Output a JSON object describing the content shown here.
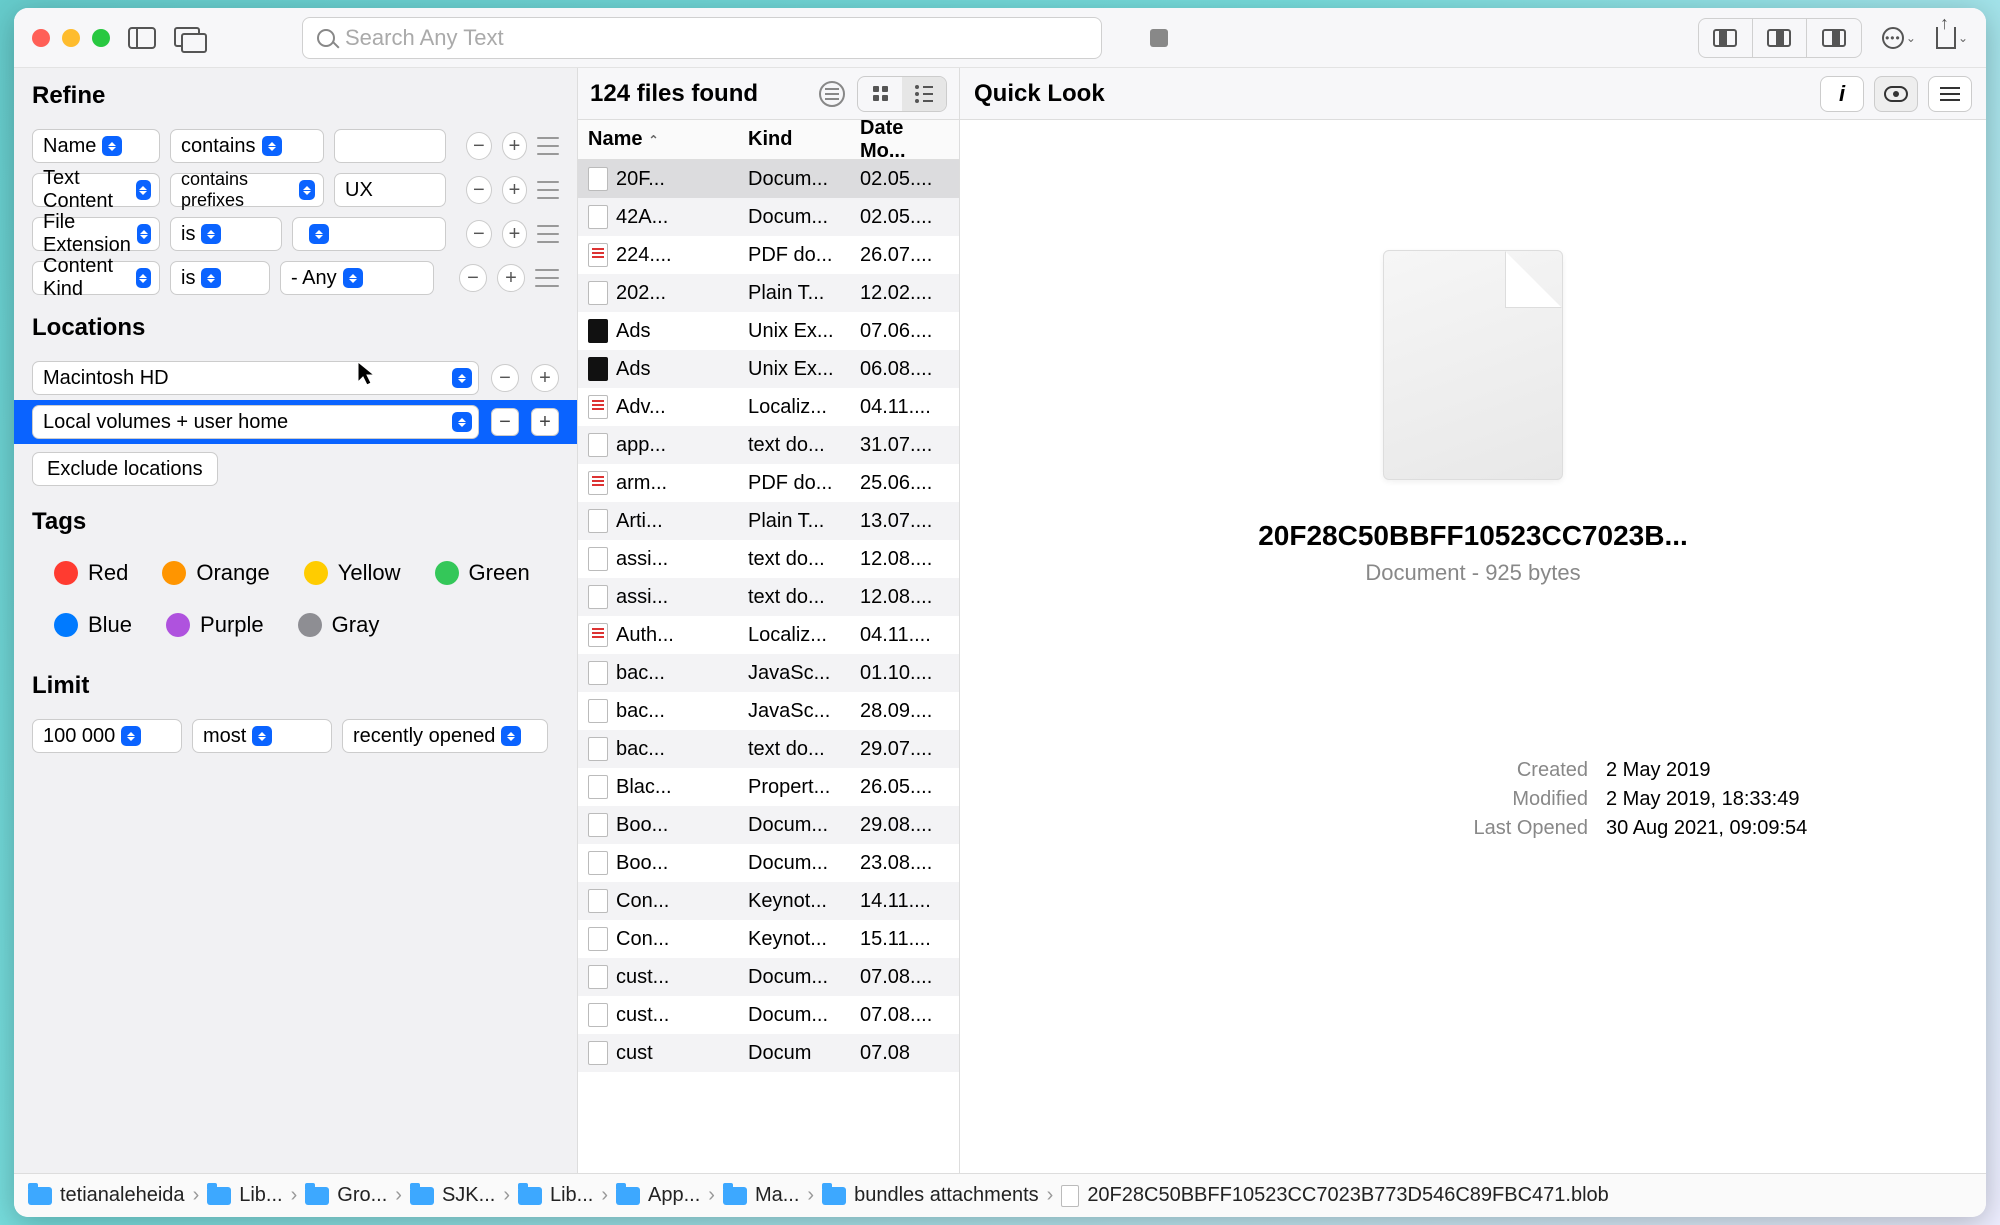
{
  "search": {
    "placeholder": "Search Any Text"
  },
  "refine": {
    "title": "Refine",
    "rows": [
      {
        "field": "Name",
        "op": "contains",
        "value": ""
      },
      {
        "field": "Text Content",
        "op": "contains prefixes",
        "value": "UX"
      },
      {
        "field": "File Extension",
        "op": "is",
        "value": ""
      },
      {
        "field": "Content Kind",
        "op": "is",
        "value": "- Any"
      }
    ]
  },
  "locations": {
    "title": "Locations",
    "items": [
      "Macintosh HD",
      "Local volumes + user home"
    ],
    "exclude_btn": "Exclude locations"
  },
  "tags": {
    "title": "Tags",
    "items": [
      {
        "name": "Red",
        "color": "#ff3b30"
      },
      {
        "name": "Orange",
        "color": "#ff9500"
      },
      {
        "name": "Yellow",
        "color": "#ffcc00"
      },
      {
        "name": "Green",
        "color": "#34c759"
      },
      {
        "name": "Blue",
        "color": "#007aff"
      },
      {
        "name": "Purple",
        "color": "#af52de"
      },
      {
        "name": "Gray",
        "color": "#8e8e93"
      }
    ]
  },
  "limit": {
    "title": "Limit",
    "count": "100 000",
    "qualifier": "most",
    "by": "recently opened"
  },
  "results": {
    "title": "124 files found",
    "columns": {
      "name": "Name",
      "kind": "Kind",
      "date": "Date Mo..."
    },
    "rows": [
      {
        "name": "20F...",
        "kind": "Docum...",
        "date": "02.05....",
        "icon": "",
        "sel": true
      },
      {
        "name": "42A...",
        "kind": "Docum...",
        "date": "02.05....",
        "icon": ""
      },
      {
        "name": "224....",
        "kind": "PDF do...",
        "date": "26.07....",
        "icon": "pdf"
      },
      {
        "name": "202...",
        "kind": "Plain T...",
        "date": "12.02....",
        "icon": ""
      },
      {
        "name": "Ads",
        "kind": "Unix Ex...",
        "date": "07.06....",
        "icon": "dk"
      },
      {
        "name": "Ads",
        "kind": "Unix Ex...",
        "date": "06.08....",
        "icon": "dk"
      },
      {
        "name": "Adv...",
        "kind": "Localiz...",
        "date": "04.11....",
        "icon": "pdf"
      },
      {
        "name": "app...",
        "kind": "text do...",
        "date": "31.07....",
        "icon": ""
      },
      {
        "name": "arm...",
        "kind": "PDF do...",
        "date": "25.06....",
        "icon": "pdf"
      },
      {
        "name": "Arti...",
        "kind": "Plain T...",
        "date": "13.07....",
        "icon": ""
      },
      {
        "name": "assi...",
        "kind": "text do...",
        "date": "12.08....",
        "icon": ""
      },
      {
        "name": "assi...",
        "kind": "text do...",
        "date": "12.08....",
        "icon": ""
      },
      {
        "name": "Auth...",
        "kind": "Localiz...",
        "date": "04.11....",
        "icon": "pdf"
      },
      {
        "name": "bac...",
        "kind": "JavaSc...",
        "date": "01.10....",
        "icon": ""
      },
      {
        "name": "bac...",
        "kind": "JavaSc...",
        "date": "28.09....",
        "icon": ""
      },
      {
        "name": "bac...",
        "kind": "text do...",
        "date": "29.07....",
        "icon": ""
      },
      {
        "name": "Blac...",
        "kind": "Propert...",
        "date": "26.05....",
        "icon": ""
      },
      {
        "name": "Boo...",
        "kind": "Docum...",
        "date": "29.08....",
        "icon": ""
      },
      {
        "name": "Boo...",
        "kind": "Docum...",
        "date": "23.08....",
        "icon": ""
      },
      {
        "name": "Con...",
        "kind": "Keynot...",
        "date": "14.11....",
        "icon": ""
      },
      {
        "name": "Con...",
        "kind": "Keynot...",
        "date": "15.11....",
        "icon": ""
      },
      {
        "name": "cust...",
        "kind": "Docum...",
        "date": "07.08....",
        "icon": ""
      },
      {
        "name": "cust...",
        "kind": "Docum...",
        "date": "07.08....",
        "icon": ""
      },
      {
        "name": "cust",
        "kind": "Docum",
        "date": "07.08",
        "icon": ""
      }
    ]
  },
  "quicklook": {
    "title": "Quick Look",
    "filename": "20F28C50BBFF10523CC7023B...",
    "subtitle": "Document - 925 bytes",
    "meta": [
      {
        "k": "Created",
        "v": "2 May 2019"
      },
      {
        "k": "Modified",
        "v": "2 May 2019, 18:33:49"
      },
      {
        "k": "Last Opened",
        "v": "30 Aug 2021, 09:09:54"
      }
    ]
  },
  "path": [
    "tetianaleheida",
    "Lib...",
    "Gro...",
    "SJK...",
    "Lib...",
    "App...",
    "Ma...",
    "bundles attachments"
  ],
  "path_file": "20F28C50BBFF10523CC7023B773D546C89FBC471.blob"
}
